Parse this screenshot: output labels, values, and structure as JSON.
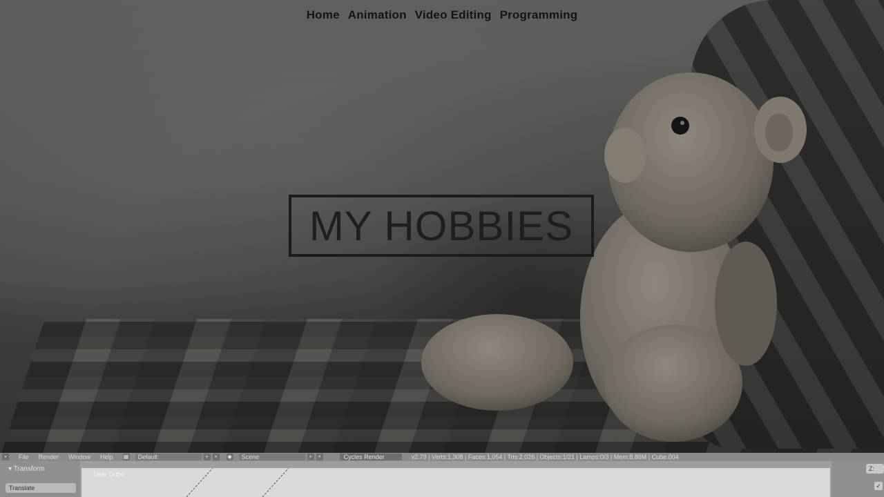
{
  "nav": {
    "items": [
      {
        "label": "Home"
      },
      {
        "label": "Animation"
      },
      {
        "label": "Video Editing"
      },
      {
        "label": "Programming"
      }
    ]
  },
  "hero": {
    "title": "MY HOBBIES"
  },
  "blender": {
    "menus": [
      "File",
      "Render",
      "Window",
      "Help"
    ],
    "layout": "Default",
    "scene": "Scene",
    "render_engine": "Cycles Render",
    "stats": "v2.79 | Verts:1,308 | Faces:1,054 | Tris:2,026 | Objects:1/21 | Lamps:0/3 | Mem:8.86M | Cube.004",
    "tool_panel": "Transform",
    "translate_button": "Translate",
    "view_label": "User Ortho",
    "right_box": "Z:",
    "check": "✓"
  }
}
